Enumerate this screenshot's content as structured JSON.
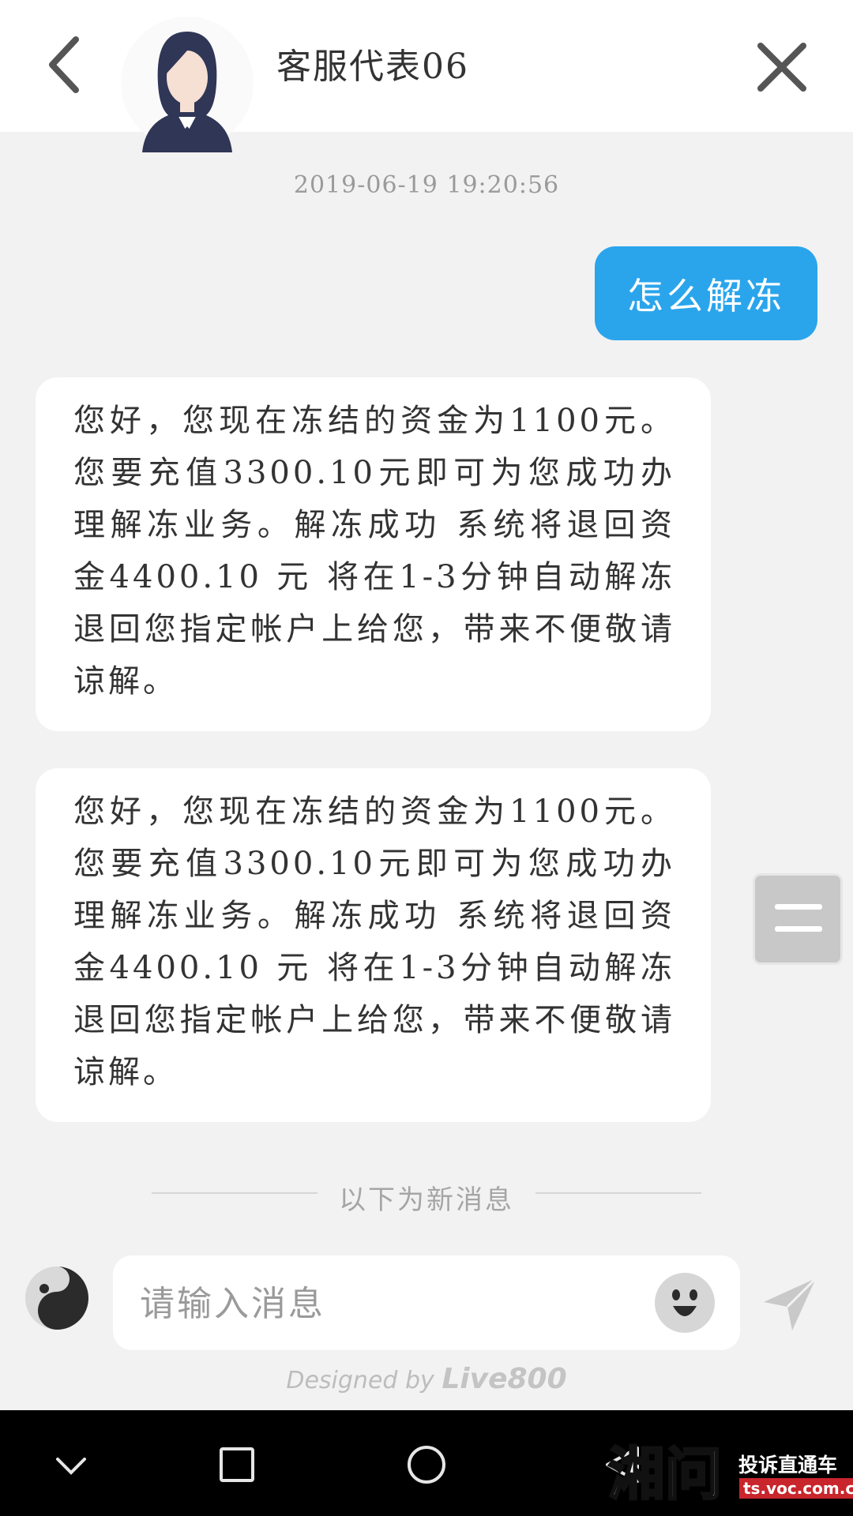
{
  "header": {
    "agent_name": "客服代表06",
    "back_icon": "chevron-left-icon",
    "close_icon": "close-icon"
  },
  "chat": {
    "timestamp": "2019-06-19 19:20:56",
    "outgoing": [
      {
        "text": "怎么解冻"
      }
    ],
    "incoming": [
      {
        "text": "您好，您现在冻结的资金为1100元。您要充值3300.10元即可为您成功办理解冻业务。解冻成功 系统将退回资金4400.10 元 将在1-3分钟自动解冻退回您指定帐户上给您，带来不便敬请谅解。"
      },
      {
        "text": "您好，您现在冻结的资金为1100元。您要充值3300.10元即可为您成功办理解冻业务。解冻成功 系统将退回资金4400.10 元 将在1-3分钟自动解冻退回您指定帐户上给您，带来不便敬请谅解。"
      }
    ],
    "new_messages_divider": "以下为新消息"
  },
  "input": {
    "placeholder": "请输入消息",
    "value": ""
  },
  "footer": {
    "designed_by": "Designed by",
    "brand": "Live800"
  },
  "watermark": {
    "logo_text": "湘问",
    "tagline": "投诉直通车",
    "site": "ts.voc.com.cn"
  },
  "colors": {
    "accent": "#2aa5ec",
    "background": "#f2f2f2",
    "bubble_in": "#ffffff"
  }
}
